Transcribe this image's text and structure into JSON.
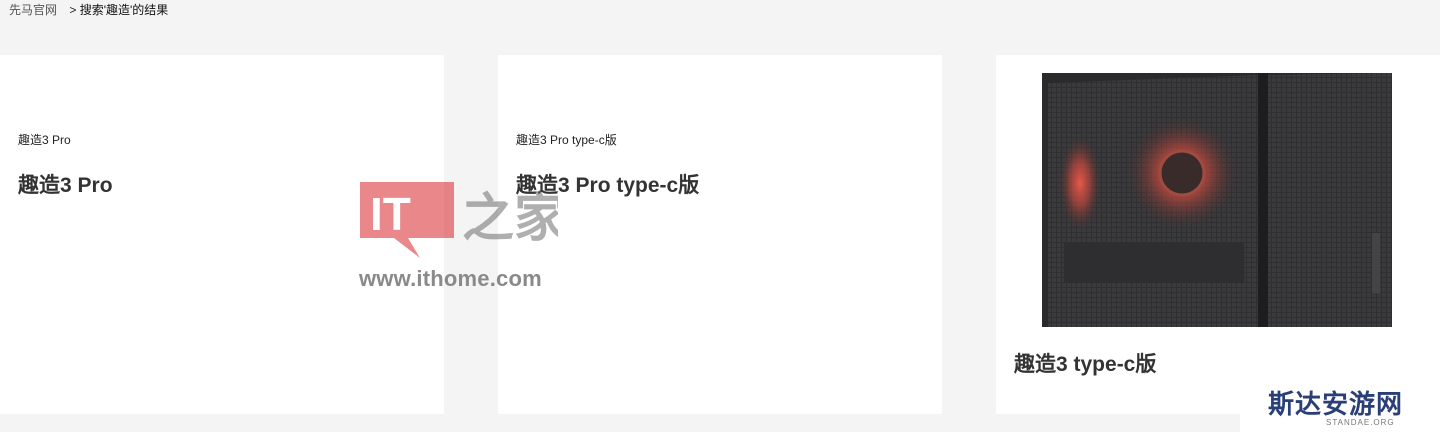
{
  "breadcrumb": {
    "home": "先马官网",
    "separator": ">",
    "current": "搜索'趣造'的结果"
  },
  "cards": [
    {
      "subtitle": "趣造3 Pro",
      "title": "趣造3 Pro"
    },
    {
      "subtitle": "趣造3 Pro type-c版",
      "title": "趣造3 Pro type-c版"
    },
    {
      "title": "趣造3 type-c版",
      "image": "pc-case-mesh-red-fan"
    }
  ],
  "watermark": {
    "logo_text": "IT之家",
    "url": "www.ithome.com",
    "color": "#d9242a"
  },
  "badge": {
    "name": "斯达安游网",
    "url": "STANDAE.ORG"
  }
}
